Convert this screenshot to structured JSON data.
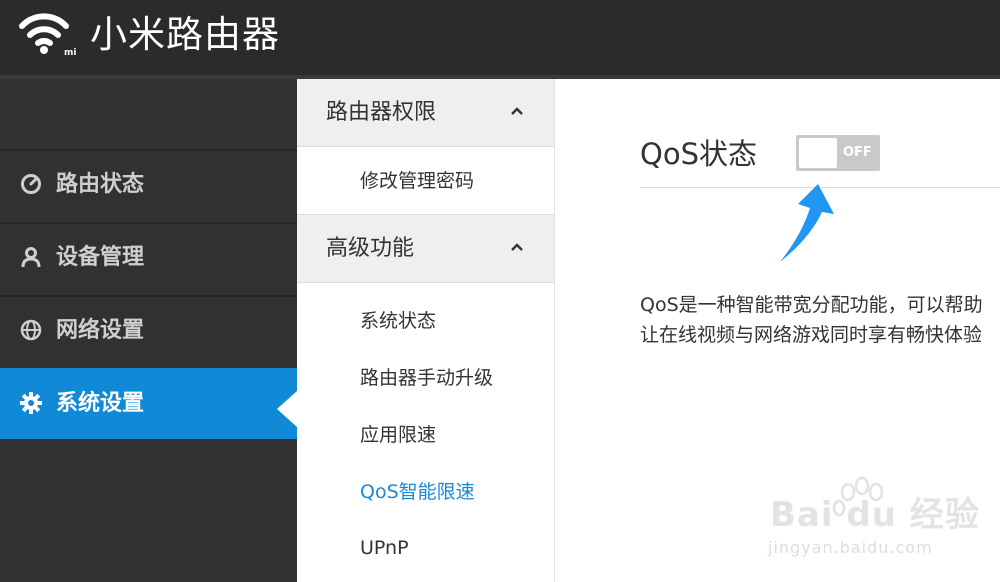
{
  "header": {
    "logo_text": "mi",
    "title": "小米路由器"
  },
  "sidebar": {
    "items": [
      {
        "label": "路由状态",
        "icon": "gauge-icon"
      },
      {
        "label": "设备管理",
        "icon": "user-icon"
      },
      {
        "label": "网络设置",
        "icon": "globe-icon"
      },
      {
        "label": "系统设置",
        "icon": "gear-icon",
        "active": true
      }
    ]
  },
  "menu": {
    "groups": [
      {
        "title": "路由器权限",
        "expanded": true,
        "items": [
          "修改管理密码"
        ]
      },
      {
        "title": "高级功能",
        "expanded": true,
        "items": [
          "系统状态",
          "路由器手动升级",
          "应用限速",
          "QoS智能限速",
          "UPnP"
        ]
      }
    ],
    "current_item": "QoS智能限速"
  },
  "main": {
    "title": "QoS状态",
    "toggle": {
      "state": "OFF"
    },
    "description_lines": [
      "QoS是一种智能带宽分配功能，可以帮助",
      "让在线视频与网络游戏同时享有畅快体验"
    ]
  },
  "watermark": {
    "text": "Bai du 经验",
    "url": "jingyan.baidu.com"
  },
  "colors": {
    "header_bg": "#2b2b2b",
    "sidebar_bg": "#313131",
    "accent": "#1089d6",
    "link_active": "#1a8ad6",
    "toggle_off": "#c9c9c9"
  }
}
